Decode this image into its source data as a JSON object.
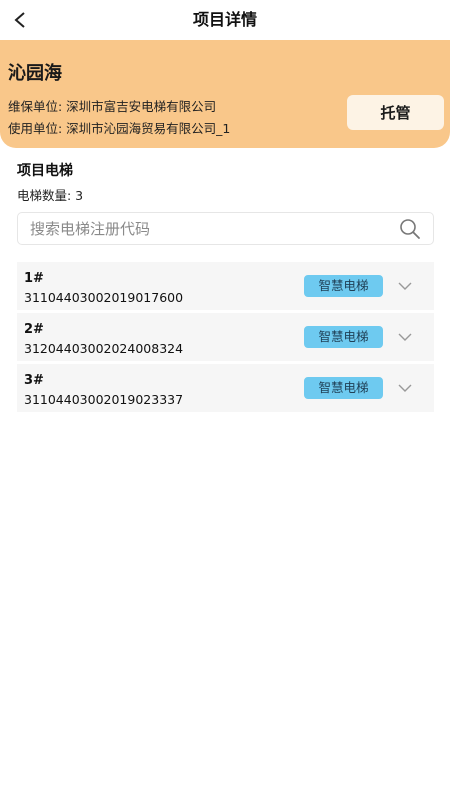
{
  "header": {
    "title": "项目详情"
  },
  "project": {
    "name": "沁园海",
    "maintenance_unit": "维保单位: 深圳市富吉安电梯有限公司",
    "using_unit": "使用单位: 深圳市沁园海贸易有限公司_1",
    "action_label": "托管"
  },
  "elevators": {
    "section_title": "项目电梯",
    "count_text": "电梯数量: 3",
    "search_placeholder": "搜索电梯注册代码",
    "items": [
      {
        "number": "1#",
        "code": "31104403002019017600",
        "badge": "智慧电梯"
      },
      {
        "number": "2#",
        "code": "31204403002024008324",
        "badge": "智慧电梯"
      },
      {
        "number": "3#",
        "code": "31104403002019023337",
        "badge": "智慧电梯"
      }
    ]
  },
  "colors": {
    "banner": "#f9c78a",
    "badge": "#6ecaf0",
    "row_bg": "#f6f6f6"
  }
}
